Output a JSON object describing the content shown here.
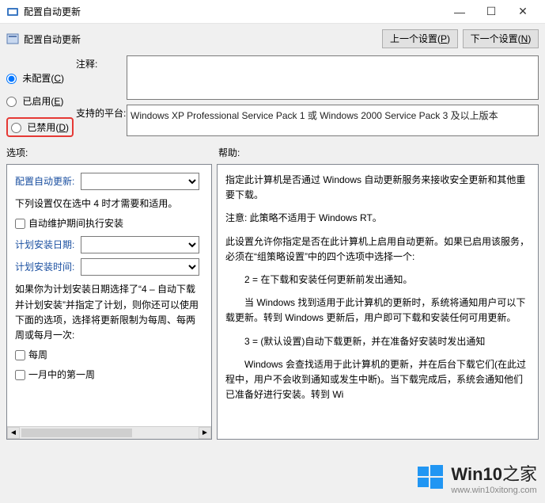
{
  "window": {
    "title": "配置自动更新",
    "min_icon": "—",
    "max_icon": "☐",
    "close_icon": "✕"
  },
  "header": {
    "title": "配置自动更新",
    "prev_label": "上一个设置",
    "prev_accel": "P",
    "next_label": "下一个设置",
    "next_accel": "N"
  },
  "radios": {
    "not_configured": "未配置",
    "not_configured_accel": "C",
    "enabled": "已启用",
    "enabled_accel": "E",
    "disabled": "已禁用",
    "disabled_accel": "D",
    "selected": "not_configured"
  },
  "comment": {
    "label": "注释:",
    "value": ""
  },
  "supported": {
    "label": "支持的平台:",
    "value": "Windows XP Professional Service Pack 1 或 Windows 2000 Service Pack 3 及以上版本"
  },
  "options": {
    "section_label": "选项:",
    "heading": "配置自动更新:",
    "note": "下列设置仅在选中 4 时才需要和适用。",
    "maintenance_chk": "自动维护期间执行安装",
    "plan_date_label": "计划安装日期:",
    "plan_time_label": "计划安装时间:",
    "plan_desc": "如果你为计划安装日期选择了“4 – 自动下载并计划安装”并指定了计划，则你还可以使用下面的选项，选择将更新限制为每周、每两周或每月一次:",
    "every_week": "每周",
    "first_week": "一月中的第一周"
  },
  "help": {
    "section_label": "帮助:",
    "p1": "指定此计算机是否通过 Windows 自动更新服务来接收安全更新和其他重要下载。",
    "p2": "注意: 此策略不适用于 Windows RT。",
    "p3": "此设置允许你指定是否在此计算机上启用自动更新。如果已启用该服务，必须在“组策略设置”中的四个选项中选择一个:",
    "p4": "2 = 在下载和安装任何更新前发出通知。",
    "p5": "当 Windows 找到适用于此计算机的更新时，系统将通知用户可以下载更新。转到 Windows 更新后，用户即可下载和安装任何可用更新。",
    "p6": "3 = (默认设置)自动下载更新，并在准备好安装时发出通知",
    "p7": "Windows 会查找适用于此计算机的更新，并在后台下载它们(在此过程中，用户不会收到通知或发生中断)。当下载完成后，系统会通知他们已准备好进行安装。转到 Wi"
  },
  "watermark": {
    "brand": "Win10",
    "suffix": "之家",
    "url": "www.win10xitong.com"
  }
}
